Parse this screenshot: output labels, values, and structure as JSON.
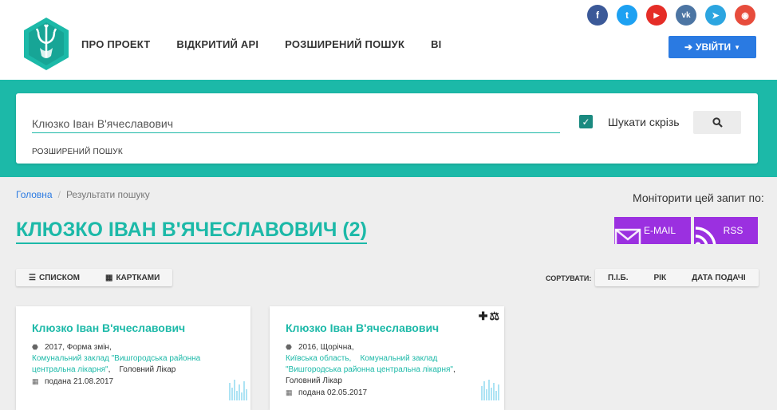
{
  "nav": [
    "ПРО ПРОЕКТ",
    "ВІДКРИТИЙ API",
    "РОЗШИРЕНИЙ ПОШУК",
    "BI"
  ],
  "socials": [
    {
      "name": "facebook",
      "glyph": "f",
      "color": "#3b5998"
    },
    {
      "name": "twitter",
      "glyph": "t",
      "color": "#1da1f2"
    },
    {
      "name": "youtube",
      "glyph": "▶",
      "color": "#e52d27"
    },
    {
      "name": "vk",
      "glyph": "vk",
      "color": "#4c75a3"
    },
    {
      "name": "telegram",
      "glyph": "➤",
      "color": "#2ca5e0"
    },
    {
      "name": "rss",
      "glyph": "◉",
      "color": "#e74c3c"
    }
  ],
  "login_label": "УВІЙТИ",
  "search": {
    "value": "Клюзко Іван В'ячеславович",
    "everywhere_label": "Шукати скрізь",
    "advanced_label": "РОЗШИРЕНИЙ ПОШУК"
  },
  "breadcrumb": {
    "home": "Головна",
    "current": "Результати пошуку"
  },
  "monitor_label": "Моніторити цей запит по:",
  "page_title": "КЛЮЗКО ІВАН В'ЯЧЕСЛАВОВИЧ (2)",
  "monitor_buttons": {
    "email": "E-MAIL",
    "rss": "RSS"
  },
  "view": {
    "list": "СПИСКОМ",
    "cards": "КАРТКАМИ"
  },
  "sort": {
    "label": "СОРТУВАТИ:",
    "options": [
      "П.І.Б.",
      "РІК",
      "ДАТА ПОДАЧІ"
    ]
  },
  "cards": [
    {
      "name": "Клюзко Іван В'ячеславович",
      "info": "2017, Форма змін,",
      "region": "",
      "org": "Комунальний заклад \"Вишгородська районна центральна лікарня\"",
      "position": "Головний Лікар",
      "filed": "подана 21.08.2017"
    },
    {
      "name": "Клюзко Іван В'ячеславович",
      "info": "2016, Щорічна,",
      "region": "Київська область,",
      "org": "Комунальний заклад \"Вишгородська районна центральна лікарня\"",
      "position": "Головний Лікар",
      "filed": "подана 02.05.2017"
    }
  ]
}
